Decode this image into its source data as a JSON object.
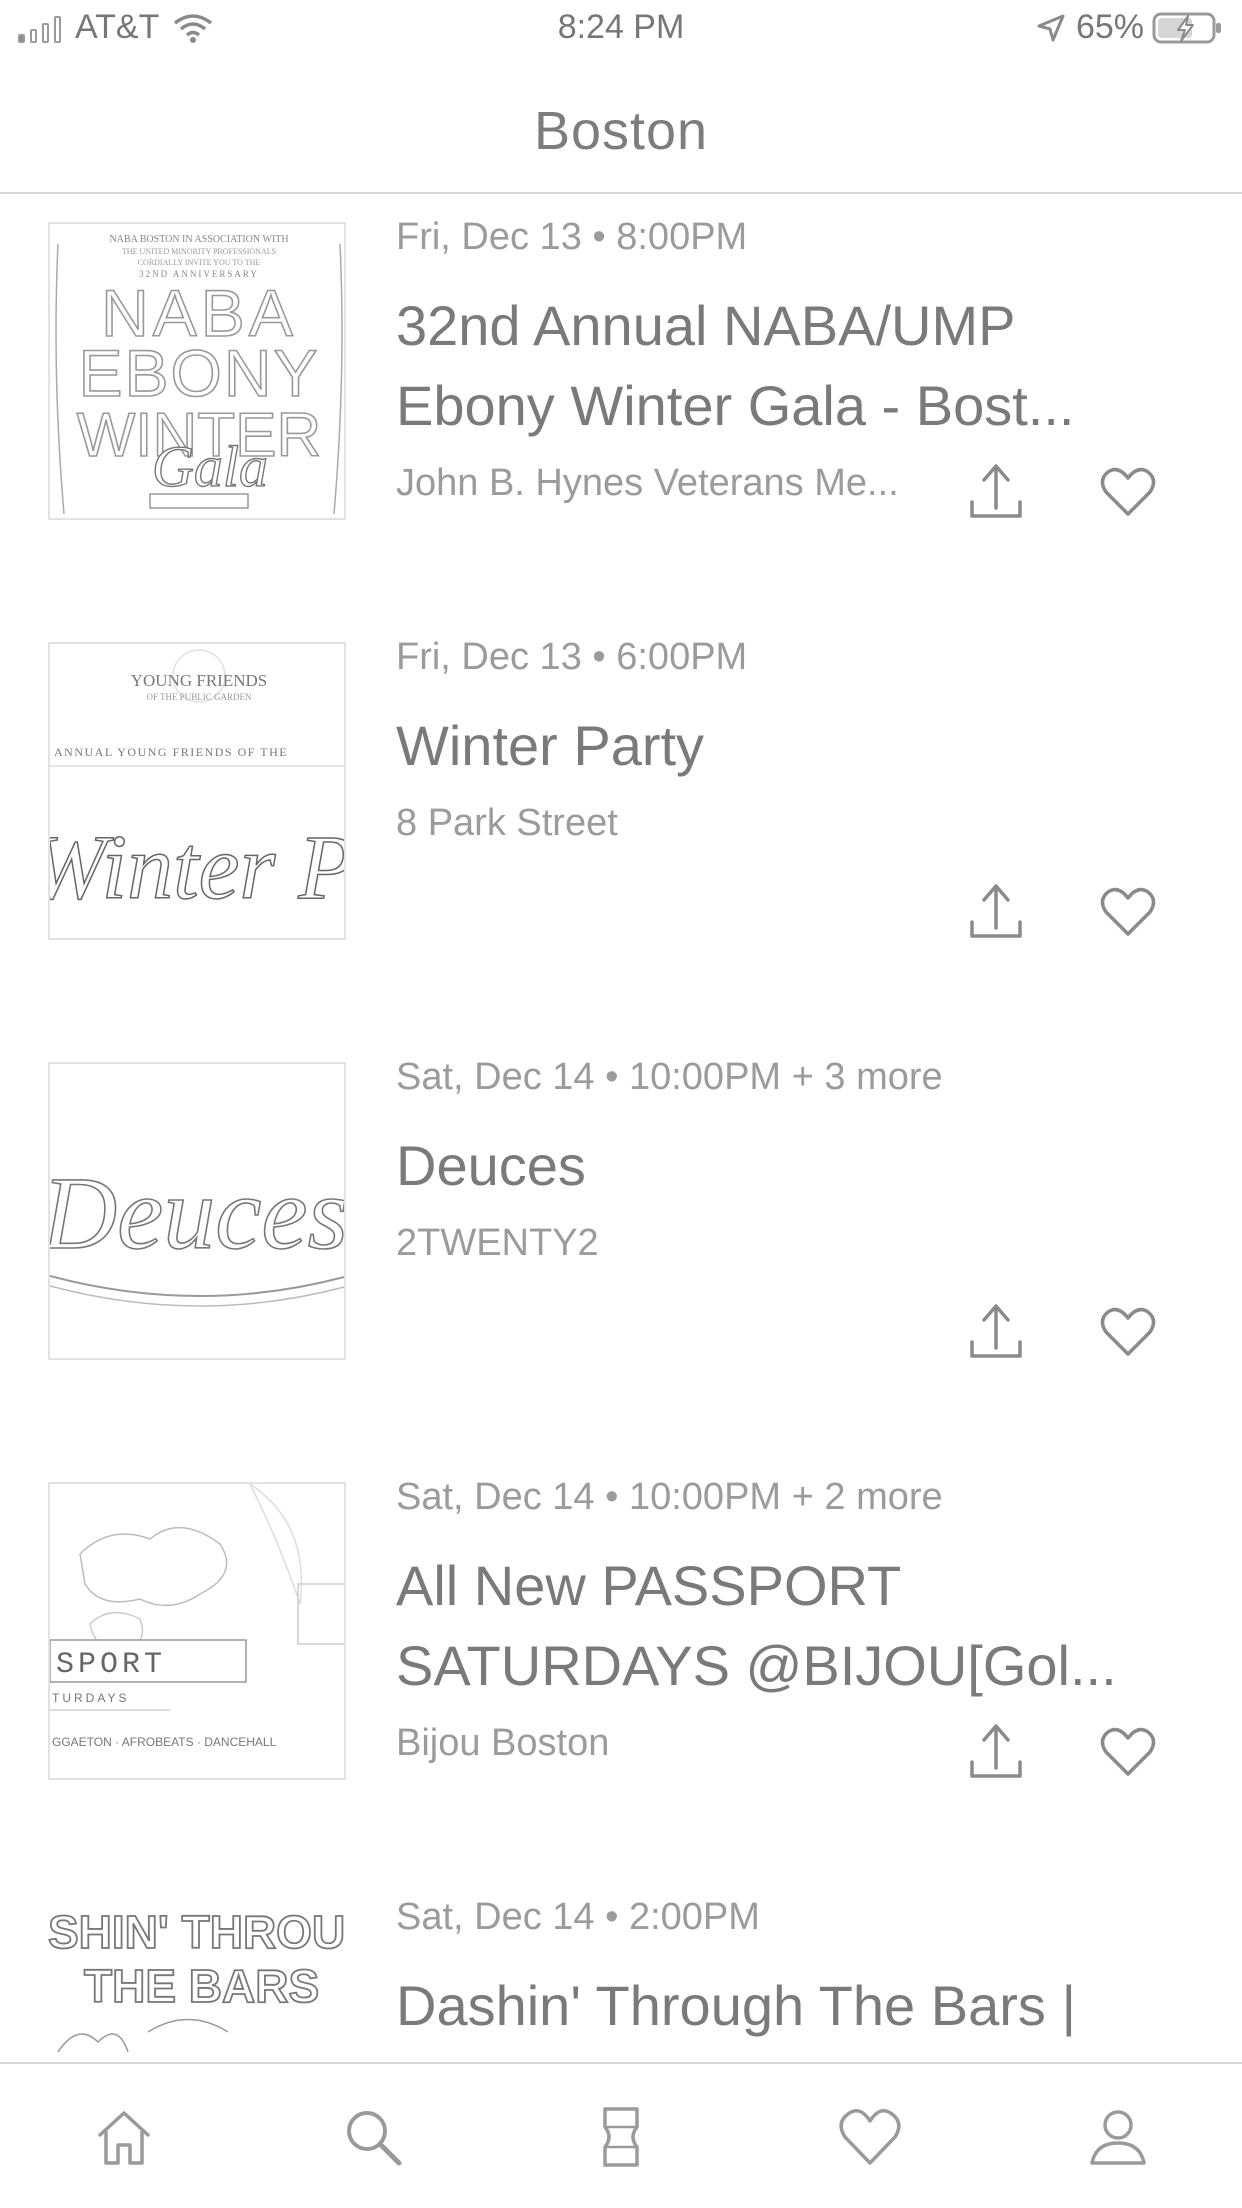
{
  "status_bar": {
    "carrier": "AT&T",
    "time": "8:24 PM",
    "battery": "65%"
  },
  "header": {
    "title": "Boston"
  },
  "events": [
    {
      "date": "Fri, Dec 13 • 8:00PM",
      "title": "32nd Annual NABA/UMP Ebony Winter Gala - Bost...",
      "venue": "John B. Hynes Veterans Me...",
      "thumb_icon": "naba-ebony-winter-gala-poster",
      "thumb_text": {
        "line1": "NABA BOSTON IN ASSOCIATION WITH",
        "line2": "THE UNITED MINORITY PROFESSIONALS",
        "line3": "CORDIALLY INVITE YOU TO THE",
        "line4": "32ND ANNIVERSARY",
        "big1": "NABA",
        "big2": "EBONY",
        "big3": "WINTER",
        "script": "Gala"
      }
    },
    {
      "date": "Fri, Dec 13 • 6:00PM",
      "title": "Winter Party",
      "venue": "8 Park Street",
      "thumb_icon": "young-friends-winter-party-poster",
      "thumb_text": {
        "line1": "YOUNG FRIENDS",
        "line2": "OF THE PUBLIC GARDEN",
        "line3": "ANNUAL YOUNG FRIENDS OF THE",
        "script": "Winter Pa"
      }
    },
    {
      "date": "Sat, Dec 14 • 10:00PM + 3 more",
      "title": "Deuces",
      "venue": "2TWENTY2",
      "thumb_icon": "deuces-script-logo",
      "thumb_text": {
        "script": "Deuces"
      }
    },
    {
      "date": "Sat, Dec 14 • 10:00PM + 2 more",
      "title": "All New PASSPORT SATURDAYS @BIJOU[Gol...",
      "venue": "Bijou Boston",
      "thumb_icon": "passport-saturdays-poster",
      "thumb_text": {
        "word": "SPORT",
        "sub": "TURDAYS",
        "genres": "GGAETON · AFROBEATS · DANCEHALL"
      }
    },
    {
      "date": "Sat, Dec 14 • 2:00PM",
      "title": "Dashin' Through The Bars |",
      "venue": "",
      "thumb_icon": "dashin-through-the-bars-poster",
      "thumb_text": {
        "line1": "SHIN' THROU",
        "line2": "THE BARS"
      }
    }
  ],
  "tab_bar": {
    "tabs": [
      {
        "name": "home",
        "icon": "home-icon"
      },
      {
        "name": "search",
        "icon": "search-icon"
      },
      {
        "name": "tickets",
        "icon": "ticket-icon"
      },
      {
        "name": "likes",
        "icon": "heart-icon"
      },
      {
        "name": "profile",
        "icon": "profile-icon"
      }
    ]
  },
  "colors": {
    "text_primary": "#7a7a7a",
    "text_secondary": "#9b9b9b",
    "divider": "#d8d8d8",
    "background": "#ffffff"
  }
}
